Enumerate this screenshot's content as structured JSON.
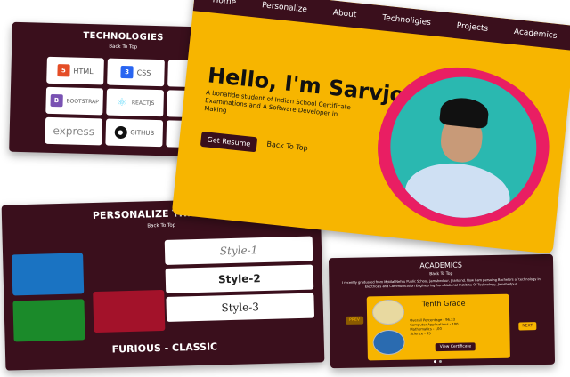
{
  "technologies": {
    "title": "TECHNOLOGIES",
    "back_to_top": "Back To Top",
    "items": [
      {
        "label": "HTML",
        "icon": "html5-icon",
        "color": "#e44d26"
      },
      {
        "label": "CSS",
        "icon": "css3-icon",
        "color": "#2965f1"
      },
      {
        "label": "",
        "icon": "javascript-icon",
        "color": "#f0db4f"
      },
      {
        "label": "BOOTSTRAP",
        "icon": "bootstrap-icon",
        "color": "#7952b3"
      },
      {
        "label": "REACTJS",
        "icon": "react-icon",
        "color": "#61dafb"
      },
      {
        "label": "",
        "icon": "nodejs-icon",
        "color": "#3c873a"
      },
      {
        "label": "express",
        "icon": "express-icon",
        "color": "#888888"
      },
      {
        "label": "GITHUB",
        "icon": "github-icon",
        "color": "#111111"
      },
      {
        "label": "",
        "icon": "figma-icon",
        "color": "#f24e1e"
      }
    ]
  },
  "hero": {
    "nav": [
      "Home",
      "Personalize",
      "About",
      "Technoligies",
      "Projects",
      "Academics"
    ],
    "title": "Hello, I'm Sarvjot",
    "description": "A bonafide student of Indian School Certificate Examinations and A Software Developer in Making",
    "resume_label": "Get Resume",
    "back_to_top": "Back To Top"
  },
  "personalize": {
    "title": "PERSONALIZE THIS PAGE",
    "back_to_top": "Back To Top",
    "swatches": [
      "#1a73c2",
      "#1b8a2a",
      "#a3122a"
    ],
    "styles": [
      "Style-1",
      "Style-2",
      "Style-3"
    ],
    "current_theme": "FURIOUS - CLASSIC"
  },
  "academics": {
    "title": "ACADEMICS",
    "back_to_top": "Back To Top",
    "description": "I recently graduated from Motilal Nehru Public School, Jamshedpur, Jharkand. Now I am persuing Bachelors of technology in Electricals and Communication Engineering from National Institute Of Technology, Jamshedpur.",
    "card_title": "Tenth Grade",
    "stats": [
      "Overall Percentage - 96.33",
      "Computer Applications - 100",
      "Mathematics - 100",
      "Science - 95"
    ],
    "view_label": "View Certificate",
    "prev_label": "PREV",
    "next_label": "NEXT"
  }
}
